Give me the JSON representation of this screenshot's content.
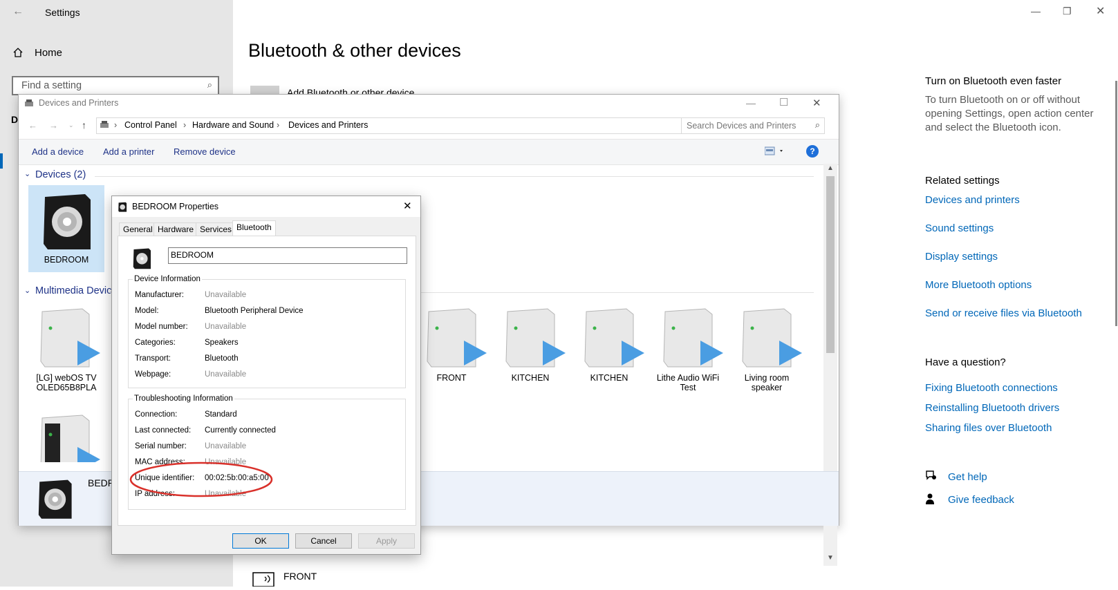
{
  "settings": {
    "title": "Settings",
    "home_label": "Home",
    "search_placeholder": "Find a setting",
    "page_title": "Bluetooth & other devices",
    "add_device_label": "Add Bluetooth or other device",
    "front_label": "FRONT",
    "right": {
      "faster_head": "Turn on Bluetooth even faster",
      "faster_text": "To turn Bluetooth on or off without opening Settings, open action center and select the Bluetooth icon.",
      "related_head": "Related settings",
      "related_links": [
        "Devices and printers",
        "Sound settings",
        "Display settings",
        "More Bluetooth options",
        "Send or receive files via Bluetooth"
      ],
      "question_head": "Have a question?",
      "question_links": [
        "Fixing Bluetooth connections",
        "Reinstalling Bluetooth drivers",
        "Sharing files over Bluetooth"
      ],
      "help_label": "Get help",
      "feedback_label": "Give feedback"
    }
  },
  "devices_window": {
    "title": "Devices and Printers",
    "breadcrumb": [
      "Control Panel",
      "Hardware and Sound",
      "Devices and Printers"
    ],
    "search_placeholder": "Search Devices and Printers",
    "toolbar": {
      "add_device": "Add a device",
      "add_printer": "Add a printer",
      "remove_device": "Remove device"
    },
    "devices_group": "Devices (2)",
    "multimedia_group": "Multimedia Devic",
    "devices": [
      {
        "label": "BEDROOM"
      }
    ],
    "multimedia": [
      {
        "label": "[LG] webOS TV OLED65B8PLA"
      },
      {
        "label": "FRONT"
      },
      {
        "label": "KITCHEN"
      },
      {
        "label": "KITCHEN"
      },
      {
        "label": "Lithe Audio WiFi Test"
      },
      {
        "label": "Living room speaker"
      }
    ],
    "status_device_name": "BEDR"
  },
  "properties": {
    "title": "BEDROOM Properties",
    "tabs": [
      "General",
      "Hardware",
      "Services",
      "Bluetooth"
    ],
    "active_tab": "Bluetooth",
    "name_value": "BEDROOM",
    "device_info_head": "Device Information",
    "device_info": [
      {
        "label": "Manufacturer:",
        "value": "Unavailable"
      },
      {
        "label": "Model:",
        "value": "Bluetooth Peripheral Device"
      },
      {
        "label": "Model number:",
        "value": "Unavailable"
      },
      {
        "label": "Categories:",
        "value": "Speakers"
      },
      {
        "label": "Transport:",
        "value": "Bluetooth"
      },
      {
        "label": "Webpage:",
        "value": "Unavailable"
      }
    ],
    "trouble_head": "Troubleshooting Information",
    "trouble_info": [
      {
        "label": "Connection:",
        "value": "Standard"
      },
      {
        "label": "Last connected:",
        "value": "Currently connected"
      },
      {
        "label": "Serial number:",
        "value": "Unavailable"
      },
      {
        "label": "MAC address:",
        "value": "Unavailable"
      },
      {
        "label": "Unique identifier:",
        "value": "00:02:5b:00:a5:00"
      },
      {
        "label": "IP address:",
        "value": "Unavailable"
      }
    ],
    "buttons": {
      "ok": "OK",
      "cancel": "Cancel",
      "apply": "Apply"
    }
  },
  "colors": {
    "link": "#0067b8",
    "annotation": "#d9302a",
    "panel_blue": "#1e3287"
  }
}
